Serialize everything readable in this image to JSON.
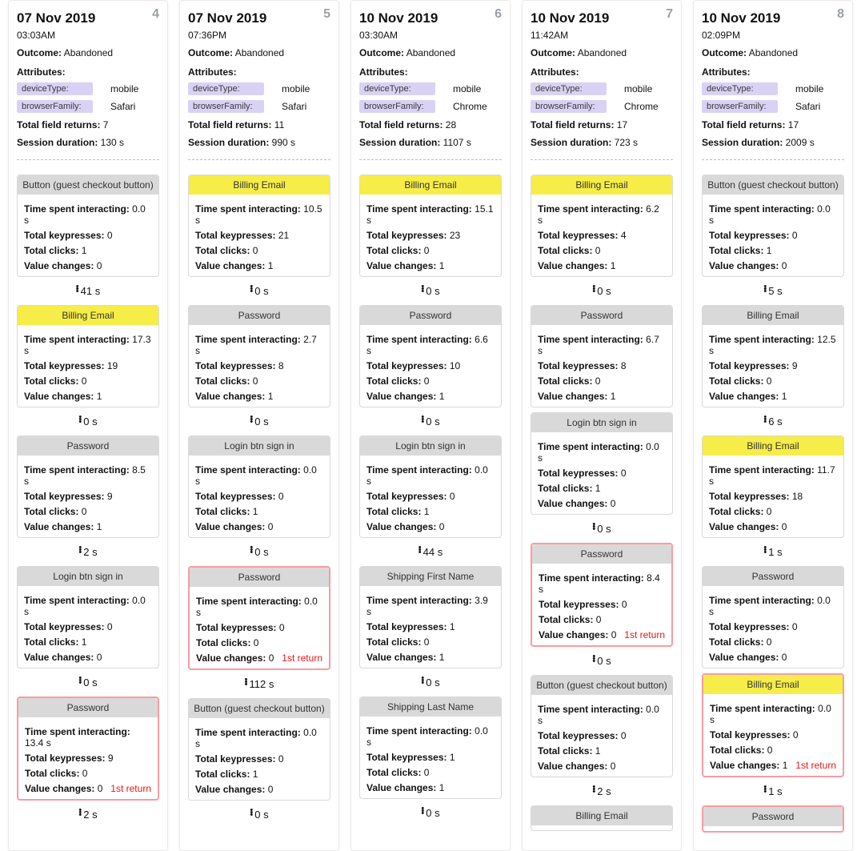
{
  "labels": {
    "outcome": "Outcome:",
    "attributes": "Attributes:",
    "deviceType": "deviceType:",
    "browserFamily": "browserFamily:",
    "totalFieldReturns": "Total field returns:",
    "sessionDuration": "Session duration:",
    "timeSpent": "Time spent interacting:",
    "totalKeypresses": "Total keypresses:",
    "totalClicks": "Total clicks:",
    "valueChanges": "Value changes:",
    "firstReturn": "1st return"
  },
  "columns": [
    {
      "index": "4",
      "date": "07 Nov 2019",
      "time": "03:03AM",
      "outcome": "Abandoned",
      "deviceType": "mobile",
      "browserFamily": "Safari",
      "totalFieldReturns": "7",
      "sessionDuration": "130 s",
      "steps": [
        {
          "title": "Button (guest checkout button)",
          "yellow": false,
          "hl": false,
          "timeSpent": "0.0 s",
          "keypresses": "0",
          "clicks": "1",
          "valueChanges": "0"
        },
        {
          "gap": "41 s"
        },
        {
          "title": "Billing Email",
          "yellow": true,
          "hl": false,
          "timeSpent": "17.3 s",
          "keypresses": "19",
          "clicks": "0",
          "valueChanges": "1"
        },
        {
          "gap": "0 s"
        },
        {
          "title": "Password",
          "yellow": false,
          "hl": false,
          "timeSpent": "8.5 s",
          "keypresses": "9",
          "clicks": "0",
          "valueChanges": "1"
        },
        {
          "gap": "2 s"
        },
        {
          "title": "Login btn sign in",
          "yellow": false,
          "hl": false,
          "timeSpent": "0.0 s",
          "keypresses": "0",
          "clicks": "1",
          "valueChanges": "0"
        },
        {
          "gap": "0 s"
        },
        {
          "title": "Password",
          "yellow": false,
          "hl": true,
          "firstReturn": true,
          "timeSpent": "13.4 s",
          "keypresses": "9",
          "clicks": "0",
          "valueChanges": "0"
        },
        {
          "gap": "2 s"
        }
      ]
    },
    {
      "index": "5",
      "date": "07 Nov 2019",
      "time": "07:36PM",
      "outcome": "Abandoned",
      "deviceType": "mobile",
      "browserFamily": "Safari",
      "totalFieldReturns": "11",
      "sessionDuration": "990 s",
      "steps": [
        {
          "title": "Billing Email",
          "yellow": true,
          "hl": false,
          "timeSpent": "10.5 s",
          "keypresses": "21",
          "clicks": "0",
          "valueChanges": "1"
        },
        {
          "gap": "0 s"
        },
        {
          "title": "Password",
          "yellow": false,
          "hl": false,
          "timeSpent": "2.7 s",
          "keypresses": "8",
          "clicks": "0",
          "valueChanges": "1"
        },
        {
          "gap": "0 s"
        },
        {
          "title": "Login btn sign in",
          "yellow": false,
          "hl": false,
          "timeSpent": "0.0 s",
          "keypresses": "0",
          "clicks": "1",
          "valueChanges": "0"
        },
        {
          "gap": "0 s"
        },
        {
          "title": "Password",
          "yellow": false,
          "hl": true,
          "firstReturn": true,
          "timeSpent": "0.0 s",
          "keypresses": "0",
          "clicks": "0",
          "valueChanges": "0"
        },
        {
          "gap": "112 s"
        },
        {
          "title": "Button (guest checkout button)",
          "yellow": false,
          "hl": false,
          "timeSpent": "0.0 s",
          "keypresses": "0",
          "clicks": "1",
          "valueChanges": "0"
        },
        {
          "gap": "0 s"
        }
      ]
    },
    {
      "index": "6",
      "date": "10 Nov 2019",
      "time": "03:30AM",
      "outcome": "Abandoned",
      "deviceType": "mobile",
      "browserFamily": "Chrome",
      "totalFieldReturns": "28",
      "sessionDuration": "1107 s",
      "steps": [
        {
          "title": "Billing Email",
          "yellow": true,
          "hl": false,
          "timeSpent": "15.1 s",
          "keypresses": "23",
          "clicks": "0",
          "valueChanges": "1"
        },
        {
          "gap": "0 s"
        },
        {
          "title": "Password",
          "yellow": false,
          "hl": false,
          "timeSpent": "6.6 s",
          "keypresses": "10",
          "clicks": "0",
          "valueChanges": "1"
        },
        {
          "gap": "0 s"
        },
        {
          "title": "Login btn sign in",
          "yellow": false,
          "hl": false,
          "timeSpent": "0.0 s",
          "keypresses": "0",
          "clicks": "1",
          "valueChanges": "0"
        },
        {
          "gap": "44 s"
        },
        {
          "title": "Shipping First Name",
          "yellow": false,
          "hl": false,
          "timeSpent": "3.9 s",
          "keypresses": "1",
          "clicks": "0",
          "valueChanges": "1"
        },
        {
          "gap": "0 s"
        },
        {
          "title": "Shipping Last Name",
          "yellow": false,
          "hl": false,
          "timeSpent": "0.0 s",
          "keypresses": "1",
          "clicks": "0",
          "valueChanges": "1"
        },
        {
          "gap": "0 s"
        }
      ]
    },
    {
      "index": "7",
      "date": "10 Nov 2019",
      "time": "11:42AM",
      "outcome": "Abandoned",
      "deviceType": "mobile",
      "browserFamily": "Chrome",
      "totalFieldReturns": "17",
      "sessionDuration": "723 s",
      "steps": [
        {
          "title": "Billing Email",
          "yellow": true,
          "hl": false,
          "timeSpent": "6.2 s",
          "keypresses": "4",
          "clicks": "0",
          "valueChanges": "1"
        },
        {
          "gap": "0 s"
        },
        {
          "title": "Password",
          "yellow": false,
          "hl": false,
          "timeSpent": "6.7 s",
          "keypresses": "8",
          "clicks": "0",
          "valueChanges": "1"
        },
        {
          "title": "Login btn sign in",
          "yellow": false,
          "hl": false,
          "timeSpent": "0.0 s",
          "keypresses": "0",
          "clicks": "1",
          "valueChanges": "0"
        },
        {
          "gap": "0 s"
        },
        {
          "title": "Password",
          "yellow": false,
          "hl": true,
          "firstReturn": true,
          "timeSpent": "8.4 s",
          "keypresses": "0",
          "clicks": "0",
          "valueChanges": "0"
        },
        {
          "gap": "0 s"
        },
        {
          "title": "Button (guest checkout button)",
          "yellow": false,
          "hl": false,
          "timeSpent": "0.0 s",
          "keypresses": "0",
          "clicks": "1",
          "valueChanges": "0"
        },
        {
          "gap": "2 s"
        },
        {
          "title": "Billing Email",
          "yellow": false,
          "hl": false,
          "partial": true
        }
      ]
    },
    {
      "index": "8",
      "date": "10 Nov 2019",
      "time": "02:09PM",
      "outcome": "Abandoned",
      "deviceType": "mobile",
      "browserFamily": "Safari",
      "totalFieldReturns": "17",
      "sessionDuration": "2009 s",
      "steps": [
        {
          "title": "Button (guest checkout button)",
          "yellow": false,
          "hl": false,
          "timeSpent": "0.0 s",
          "keypresses": "0",
          "clicks": "1",
          "valueChanges": "0"
        },
        {
          "gap": "5 s"
        },
        {
          "title": "Billing Email",
          "yellow": false,
          "hl": false,
          "timeSpent": "12.5 s",
          "keypresses": "9",
          "clicks": "0",
          "valueChanges": "1"
        },
        {
          "gap": "6 s"
        },
        {
          "title": "Billing Email",
          "yellow": true,
          "hl": false,
          "timeSpent": "11.7 s",
          "keypresses": "18",
          "clicks": "0",
          "valueChanges": "0"
        },
        {
          "gap": "1 s"
        },
        {
          "title": "Password",
          "yellow": false,
          "hl": false,
          "timeSpent": "0.0 s",
          "keypresses": "0",
          "clicks": "0",
          "valueChanges": "0"
        },
        {
          "title": "Billing Email",
          "yellow": true,
          "hl": true,
          "firstReturn": true,
          "timeSpent": "0.0 s",
          "keypresses": "0",
          "clicks": "0",
          "valueChanges": "1"
        },
        {
          "gap": "1 s"
        },
        {
          "title": "Password",
          "yellow": false,
          "hl": true,
          "partial": true
        }
      ]
    }
  ]
}
